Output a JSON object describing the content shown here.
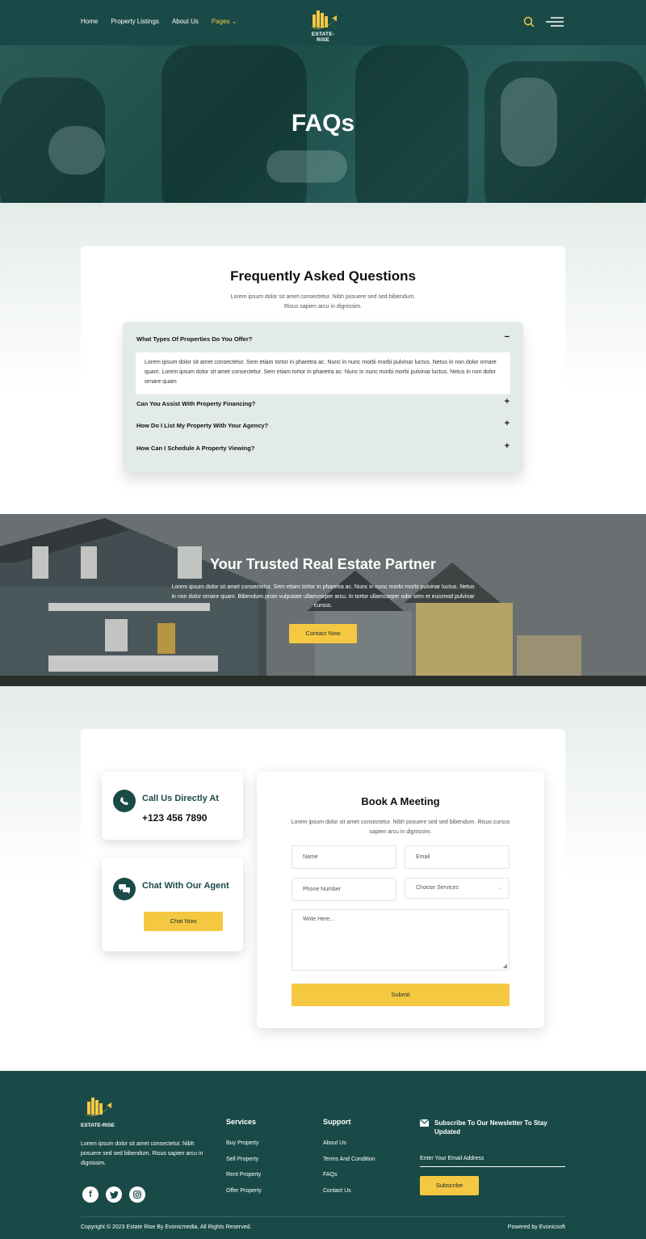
{
  "header": {
    "nav": [
      "Home",
      "Property Listings",
      "About Us",
      "Pages"
    ],
    "logo_text": "ESTATE-RISE"
  },
  "hero": {
    "title": "FAQs"
  },
  "faq": {
    "heading": "Frequently Asked Questions",
    "subtitle": "Lorem ipsum dolor sit amet consectetur. Nibh posuere sed sed bibendum. Risus sapien arcu in dignissim.",
    "items": [
      {
        "question": "What Types Of Properties Do You Offer?",
        "toggle": "−",
        "answer": "Lorem ipsum dolor sit amet consectetur. Sem etiam tortor in pharetra ac. Nunc in nunc morbi morbi pulvinar luctus. Netus in non dolor ornare quam. Lorem ipsum dolor sit amet consectetur. Sem etiam tortor in pharetra ac. Nunc in nunc morbi morbi pulvinar luctus. Netus in non dolor ornare quam"
      },
      {
        "question": "Can You Assist With Property Financing?",
        "toggle": "+"
      },
      {
        "question": "How Do I List My Property With Your Agency?",
        "toggle": "+"
      },
      {
        "question": "How Can I Schedule A Property Viewing?",
        "toggle": "+"
      }
    ]
  },
  "partner": {
    "title": "Your Trusted Real Estate Partner",
    "text": "Lorem ipsum dolor sit amet consectetur. Sem etiam tortor in pharetra ac. Nunc in nunc morbi morbi pulvinar luctus. Netus in non dolor ornare quam. Bibendum proin vulputate ullamcorper arcu. In tortor ullamcorper odio sem et euismod pulvinar cursus.",
    "button": "Contact Now"
  },
  "contact": {
    "call_title": "Call Us Directly At",
    "phone": "+123 456 7890",
    "chat_title": "Chat With Our Agent",
    "chat_button": "Chat Now"
  },
  "form": {
    "title": "Book A Meeting",
    "subtitle": "Lorem ipsum dolor sit amet consectetur. Nibh posuere sed sed bibendum. Risus cursus sapien arcu in dignissim.",
    "name_placeholder": "Name",
    "email_placeholder": "Email",
    "phone_placeholder": "Phone Number",
    "service_value": "Choose Services",
    "message_placeholder": "Write Here...",
    "submit": "Submit"
  },
  "footer": {
    "logo_text": "ESTATE-RISE",
    "about": "Lorem ipsum dolor sit amet consectetur. Nibh posuere sed sed bibendum. Risus sapien arcu in dignissim.",
    "services_title": "Services",
    "services": [
      "Buy Property",
      "Sell Property",
      "Rent Property",
      "Offer Property"
    ],
    "support_title": "Support",
    "support": [
      "About Us",
      "Terms And Condition",
      "FAQs",
      "Contact Us"
    ],
    "newsletter_title": "Subscribe To Our Newsletter To Stay Updated",
    "email_placeholder": "Enter Your Email Address",
    "subscribe": "Subscribe",
    "copyright": "Copyright © 2023 Estate Rise By Evonicmedia. All Rights Reserved.",
    "powered": "Powered by Evonicsoft"
  },
  "colors": {
    "primary": "#1a4a47",
    "accent": "#f5c842",
    "light_bg": "#e3ebe6"
  }
}
